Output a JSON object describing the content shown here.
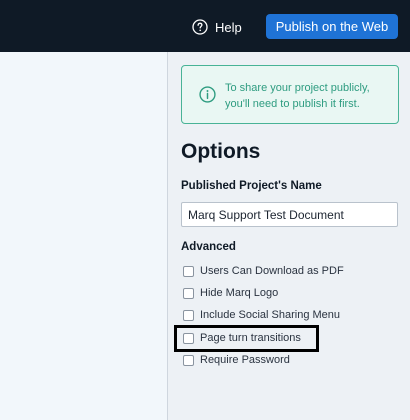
{
  "header": {
    "help_label": "Help",
    "publish_label": "Publish on the Web"
  },
  "notice": {
    "text": "To share your project publicly, you'll need to publish it first."
  },
  "options": {
    "title": "Options",
    "name_label": "Published Project's Name",
    "name_value": "Marq Support Test Document",
    "advanced_label": "Advanced",
    "checkboxes": [
      {
        "label": "Users Can Download as PDF",
        "checked": false
      },
      {
        "label": "Hide Marq Logo",
        "checked": false
      },
      {
        "label": "Include Social Sharing Menu",
        "checked": false
      },
      {
        "label": "Page turn transitions",
        "checked": false
      },
      {
        "label": "Require Password",
        "checked": false
      }
    ]
  },
  "colors": {
    "topbar": "#0f1a26",
    "publish_button": "#1f73d6",
    "notice_border": "#48b396",
    "notice_text": "#2e9c80",
    "highlight_box": "#000000"
  },
  "icons": {
    "help": "help-circle-icon",
    "notice": "info-circle-icon"
  }
}
